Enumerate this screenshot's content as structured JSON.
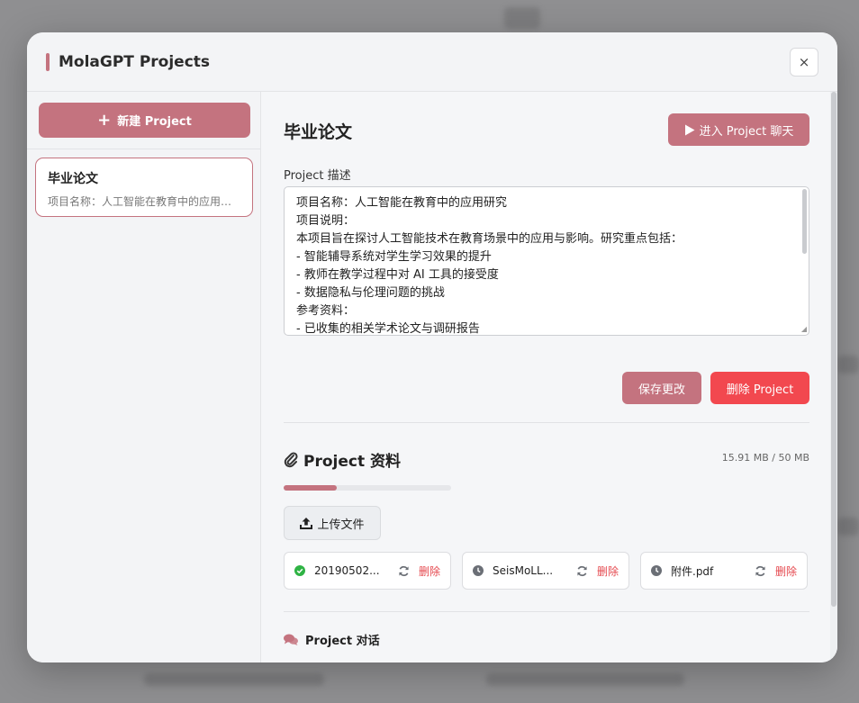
{
  "modal": {
    "title": "MolaGPT Projects",
    "close_label": "×"
  },
  "sidebar": {
    "new_button_label": "新建 Project",
    "projects": [
      {
        "title": "毕业论文",
        "desc": "项目名称：人工智能在教育中的应用研究"
      }
    ]
  },
  "project": {
    "title": "毕业论文",
    "enter_chat_label": "进入 Project 聊天",
    "desc_label": "Project 描述",
    "description_lines": [
      "项目名称：人工智能在教育中的应用研究",
      "项目说明：",
      "本项目旨在探讨人工智能技术在教育场景中的应用与影响。研究重点包括：",
      "- 智能辅导系统对学生学习效果的提升",
      "- 教师在教学过程中对 AI 工具的接受度",
      "- 数据隐私与伦理问题的挑战",
      "参考资料：",
      "- 已收集的相关学术论文与调研报告"
    ],
    "save_label": "保存更改",
    "delete_label": "删除 Project"
  },
  "files": {
    "title": "Project 资料",
    "storage_text": "15.91 MB / 50 MB",
    "storage_fraction": 0.318,
    "upload_label": "上传文件",
    "items": [
      {
        "name": "20190502...",
        "status": "done",
        "delete_label": "删除"
      },
      {
        "name": "SeisMoLL...",
        "status": "pending",
        "delete_label": "删除"
      },
      {
        "name": "附件.pdf",
        "status": "pending",
        "delete_label": "删除"
      }
    ]
  },
  "chats": {
    "title": "Project 对话"
  },
  "colors": {
    "accent": "#c4737f",
    "danger": "#f2484f",
    "success": "#2fb344",
    "muted": "#6b6f76"
  },
  "icons": {
    "plus": "plus-icon",
    "play": "play-icon",
    "paperclip": "paperclip-icon",
    "upload": "upload-icon",
    "check": "check-circle-icon",
    "clock": "clock-icon",
    "refresh": "refresh-icon",
    "comments": "comments-icon",
    "close": "close-icon"
  }
}
